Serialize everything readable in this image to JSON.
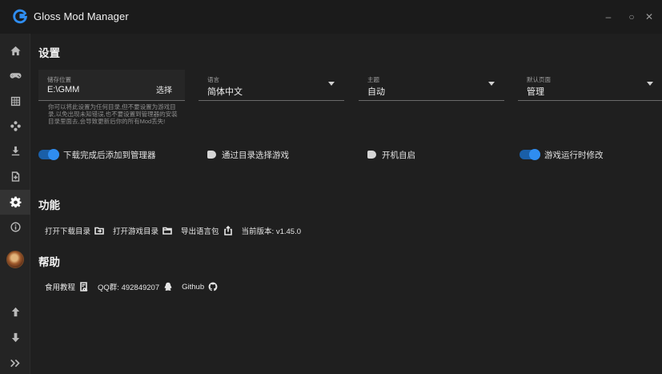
{
  "app": {
    "title": "Gloss Mod Manager"
  },
  "window": {
    "minimize": "–",
    "maximize": "○",
    "close": "✕"
  },
  "sidebar": {
    "items": [
      {
        "name": "home-icon"
      },
      {
        "name": "gamepad-icon"
      },
      {
        "name": "grid-icon"
      },
      {
        "name": "mods-icon"
      },
      {
        "name": "download-icon"
      },
      {
        "name": "file-icon"
      },
      {
        "name": "gear-icon",
        "active": true
      },
      {
        "name": "info-icon"
      }
    ],
    "bottom": [
      {
        "name": "arrow-up-icon"
      },
      {
        "name": "arrow-down-icon"
      },
      {
        "name": "expand-icon"
      }
    ]
  },
  "settings": {
    "title": "设置",
    "storage": {
      "label": "储存位置",
      "value": "E:\\GMM",
      "action": "选择"
    },
    "language": {
      "label": "语言",
      "value": "简体中文"
    },
    "theme": {
      "label": "主题",
      "value": "自动"
    },
    "default_page": {
      "label": "默认页面",
      "value": "管理"
    },
    "hint": "你可以将此设置为任何目录,但不要设置为游戏目录,以免出现未知错误,也不要设置到管理器的安装目录里面去,会导致更新后你的所有Mod丢失!",
    "toggles": [
      {
        "label": "下载完成后添加到管理器",
        "on": true
      },
      {
        "label": "通过目录选择游戏",
        "on": false
      },
      {
        "label": "开机自启",
        "on": false
      },
      {
        "label": "游戏运行时修改",
        "on": true
      }
    ]
  },
  "features": {
    "title": "功能",
    "open_download_dir": "打开下载目录",
    "open_game_dir": "打开游戏目录",
    "export_language": "导出语言包",
    "version": "当前版本: v1.45.0"
  },
  "help": {
    "title": "帮助",
    "tutorial": "食用教程",
    "qq_group": "QQ群: 492849207",
    "github": "Github"
  },
  "colors": {
    "accent": "#2f8df0",
    "background": "#1f1f1f",
    "sidebar": "#242424"
  }
}
